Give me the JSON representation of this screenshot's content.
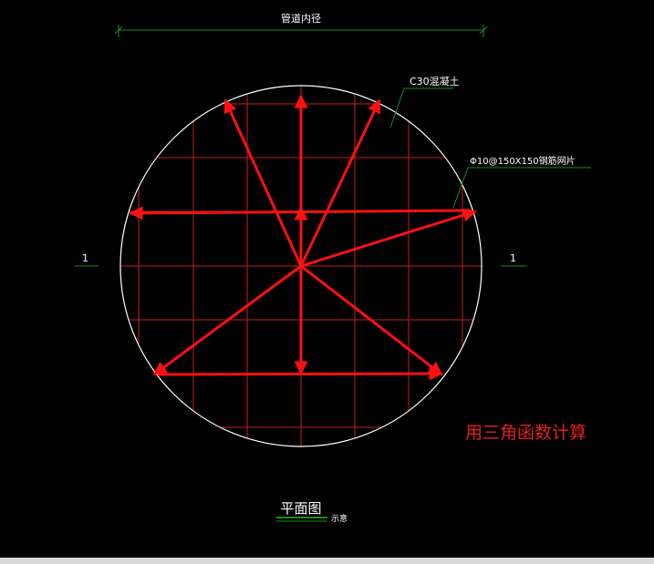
{
  "drawing": {
    "dimension_label": "管道内径",
    "concrete_label": "C30混凝土",
    "rebar_label": "Φ10@150X150钢筋网片",
    "section_mark_left": "1",
    "section_mark_right": "1",
    "note": "用三角函数计算",
    "title": "平面图",
    "title_sub": "示意"
  },
  "colors": {
    "background": "#000000",
    "circle": "#ffffff",
    "grid": "#c81e1e",
    "arrows": "#ff1010",
    "dimension": "#1a8c1a",
    "leader": "#1a8c1a",
    "note": "#e02020"
  }
}
